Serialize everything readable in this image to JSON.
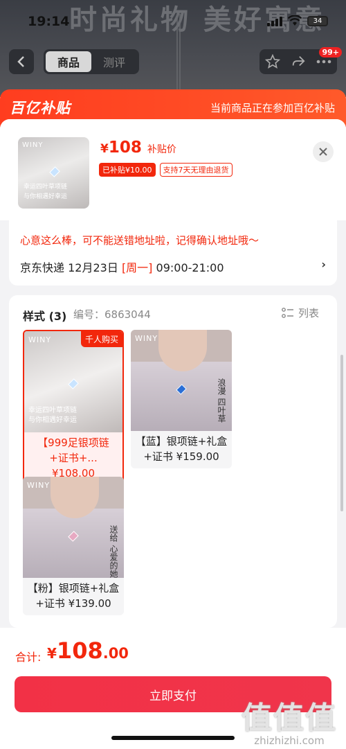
{
  "status_bar": {
    "time": "19:14",
    "battery": "34"
  },
  "background": {
    "banner": "时尚礼物 美好寓意",
    "tabs": [
      "商品",
      "测评"
    ],
    "cart_badge": "99+"
  },
  "subsidy": {
    "logo": "百亿补贴",
    "note": "当前商品正在参加百亿补贴"
  },
  "product": {
    "thumb_brand": "WINY",
    "thumb_caption": [
      "幸运四叶草项链",
      "与你相遇好幸运"
    ],
    "currency": "¥",
    "price": "108",
    "price_label": "补贴价",
    "tag_subsidy": "已补贴¥10.00",
    "tag_return": "支持7天无理由退货"
  },
  "delivery": {
    "warning": "心意这么棒，可不能送错地址啦，记得确认地址哦～",
    "carrier": "京东快递",
    "date": "12月23日",
    "weekday": "[周一]",
    "window": "09:00-21:00"
  },
  "styles": {
    "title": "样式 (3)",
    "code": "编号：6863044",
    "list_label": "列表",
    "options": [
      {
        "label": "【999足银项链+证书+... ¥108.00",
        "badge": "千人购买",
        "brand": "WINY",
        "caption": [
          "幸运四叶草项链",
          "与你相遇好幸运"
        ],
        "selected": true
      },
      {
        "label": "【蓝】银项链+礼盒+证书 ¥159.00",
        "brand": "WINY",
        "vertical": "浪漫 四叶草",
        "selected": false
      },
      {
        "label": "【粉】银项链+礼盒+证书 ¥139.00",
        "brand": "WINY",
        "vertical": "送给 心爱的她",
        "selected": false
      }
    ]
  },
  "footer": {
    "total_label": "合计:",
    "currency": "¥",
    "total_int": "108",
    "total_dec": ".00",
    "pay_label": "立即支付",
    "watermark_big": "值值值",
    "watermark_small": "zhizhizhi.com"
  }
}
